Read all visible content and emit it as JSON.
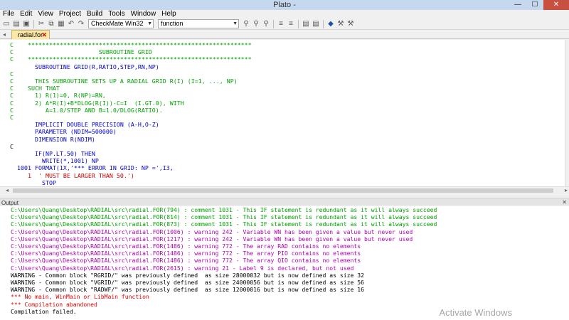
{
  "window": {
    "title": "Plato -",
    "minimize": "—",
    "maximize": "☐",
    "close": "✕"
  },
  "menu": [
    "File",
    "Edit",
    "View",
    "Project",
    "Build",
    "Tools",
    "Window",
    "Help"
  ],
  "toolbar": {
    "config_combo": "CheckMate Win32",
    "function_combo": "function",
    "icons": [
      "new-file-icon",
      "open-folder-icon",
      "save-icon",
      "cut-icon",
      "copy-icon",
      "paste-icon",
      "undo-icon",
      "redo-icon",
      "find-icon",
      "replace-icon",
      "find-next-icon",
      "indent-icon",
      "outdent-icon",
      "comment-icon",
      "uncomment-icon",
      "build-icon",
      "run-icon",
      "debug-icon"
    ]
  },
  "tab": {
    "pin": "◂",
    "name": "radial.for",
    "close": "✕"
  },
  "code": [
    {
      "t": "C    ***************************************************************",
      "c": "c-comment"
    },
    {
      "t": "C                        SUBROUTINE GRID",
      "c": "c-comment"
    },
    {
      "t": "C    ***************************************************************",
      "c": "c-comment"
    },
    {
      "t": "       SUBROUTINE GRID(R,RATIO,STEP,RN,NP)",
      "c": "c-kw"
    },
    {
      "t": "C",
      "c": "c-comment"
    },
    {
      "t": "C      THIS SUBROUTINE SETS UP A RADIAL GRID R(I) (I=1, ..., NP)",
      "c": "c-comment"
    },
    {
      "t": "C    SUCH THAT",
      "c": "c-comment"
    },
    {
      "t": "C      1) R(1)=0, R(NP)=RN,",
      "c": "c-comment"
    },
    {
      "t": "C      2) A*R(I)+B*DLOG(R(I))-C=I  (I.GT.0), WITH",
      "c": "c-comment"
    },
    {
      "t": "C         A=1.0/STEP AND B=1.0/DLOG(RATIO).",
      "c": "c-comment"
    },
    {
      "t": "C",
      "c": "c-comment"
    },
    {
      "t": "       IMPLICIT DOUBLE PRECISION (A-H,O-Z)",
      "c": "c-kw"
    },
    {
      "t": "       PARAMETER (NDIM=500000)",
      "c": "c-kw"
    },
    {
      "t": "       DIMENSION R(NDIM)",
      "c": "c-kw"
    },
    {
      "t": "C",
      "c": "c-plain"
    },
    {
      "t": "       IF(NP.LT.50) THEN",
      "c": "c-kw"
    },
    {
      "t": "         WRITE(*,1001) NP",
      "c": "c-kw"
    },
    {
      "t": "  1001 FORMAT(1X,'*** ERROR IN GRID: NP =',I3,",
      "c": "c-kw"
    },
    {
      "t": "     1  ' MUST BE LARGER THAN 50.')",
      "c": "c-str"
    },
    {
      "t": "         STOP",
      "c": "c-kw"
    }
  ],
  "output": {
    "header": "Output",
    "close": "✕",
    "lines": [
      {
        "t": "C:\\Users\\Quang\\Desktop\\RADIAL\\src\\radial.FOR(794) : comment 1031 - This IF statement is redundant as it will always succeed",
        "c": "o-green"
      },
      {
        "t": "C:\\Users\\Quang\\Desktop\\RADIAL\\src\\radial.FOR(814) : comment 1031 - This IF statement is redundant as it will always succeed",
        "c": "o-green"
      },
      {
        "t": "C:\\Users\\Quang\\Desktop\\RADIAL\\src\\radial.FOR(873) : comment 1031 - This IF statement is redundant as it will always succeed",
        "c": "o-green"
      },
      {
        "t": "C:\\Users\\Quang\\Desktop\\RADIAL\\src\\radial.FOR(1006) : warning 242 - Variable WN has been given a value but never used",
        "c": "o-purple"
      },
      {
        "t": "C:\\Users\\Quang\\Desktop\\RADIAL\\src\\radial.FOR(1217) : warning 242 - Variable WN has been given a value but never used",
        "c": "o-purple"
      },
      {
        "t": "C:\\Users\\Quang\\Desktop\\RADIAL\\src\\radial.FOR(1486) : warning 772 - The array RAD contains no elements",
        "c": "o-purple"
      },
      {
        "t": "C:\\Users\\Quang\\Desktop\\RADIAL\\src\\radial.FOR(1486) : warning 772 - The array PIO contains no elements",
        "c": "o-purple"
      },
      {
        "t": "C:\\Users\\Quang\\Desktop\\RADIAL\\src\\radial.FOR(1486) : warning 772 - The array QIO contains no elements",
        "c": "o-purple"
      },
      {
        "t": "C:\\Users\\Quang\\Desktop\\RADIAL\\src\\radial.FOR(2615) : warning 21 - Label 9 is declared, but not used",
        "c": "o-purple"
      },
      {
        "t": "WARNING - Common block \"RGRID/\" was previously defined  as size 28000032 but is now defined as size 32",
        "c": "o-black"
      },
      {
        "t": "WARNING - Common block \"VGRID/\" was previously defined  as size 24000056 but is now defined as size 56",
        "c": "o-black"
      },
      {
        "t": "WARNING - Common block \"RADWF/\" was previously defined  as size 12000016 but is now defined as size 16",
        "c": "o-black"
      },
      {
        "t": "*** No main, WinMain or LibMain function",
        "c": "o-red"
      },
      {
        "t": "*** Compilation abandoned",
        "c": "o-red"
      },
      {
        "t": "Compilation failed.",
        "c": "o-black"
      }
    ]
  },
  "watermark": "Activate Windows"
}
